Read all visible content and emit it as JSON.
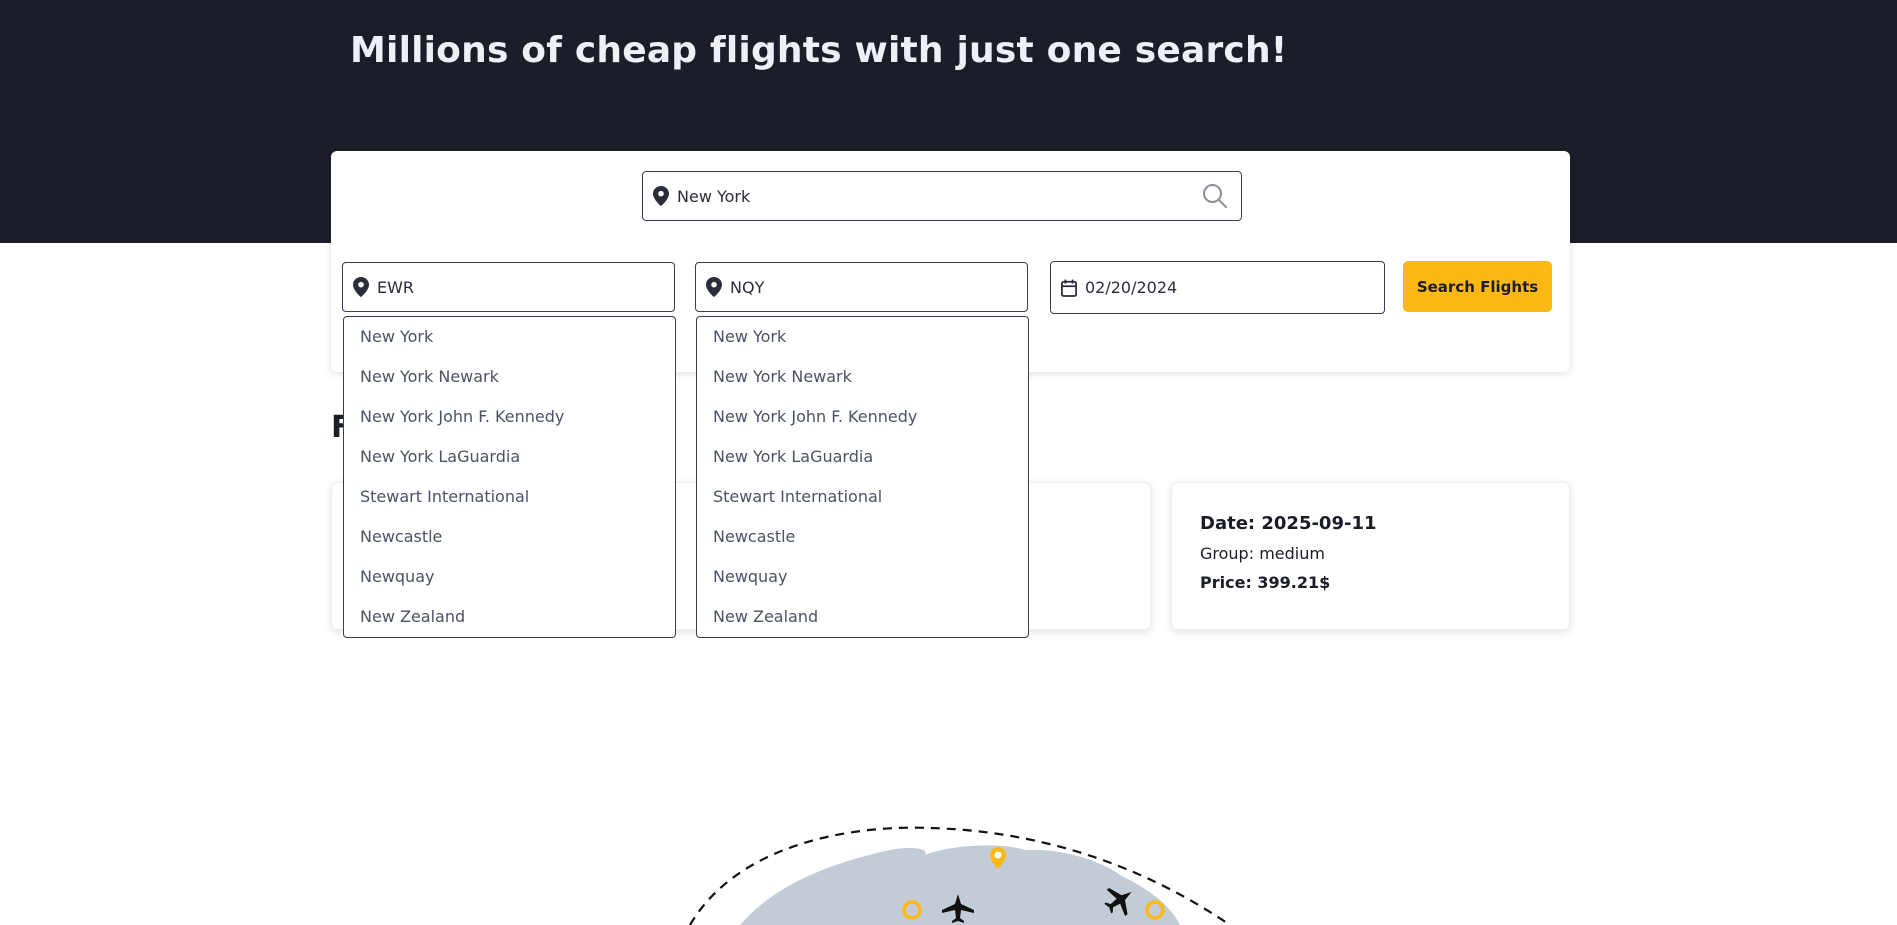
{
  "hero": {
    "title": "Millions of cheap flights with just one search!"
  },
  "search": {
    "city_value": "New York",
    "from_value": "EWR",
    "to_value": "NQY",
    "date_value": "02/20/2024",
    "button_label": "Search Flights"
  },
  "dropdowns": {
    "from_options": [
      "New York",
      "New York Newark",
      "New York John F. Kennedy",
      "New York LaGuardia",
      "Stewart International",
      "Newcastle",
      "Newquay",
      "New Zealand"
    ],
    "to_options": [
      "New York",
      "New York Newark",
      "New York John F. Kennedy",
      "New York LaGuardia",
      "Stewart International",
      "Newcastle",
      "Newquay",
      "New Zealand"
    ]
  },
  "results": {
    "section_title_visible": "F",
    "cards": [
      {
        "date": "Date: 2025-09-11",
        "group": "Group: medium",
        "price": "Price: 399.21$"
      }
    ]
  },
  "colors": {
    "hero_bg": "#1b1d29",
    "accent": "#fdb813",
    "globe": "#c3ccd6"
  },
  "icons": [
    "map-pin-icon",
    "search-icon",
    "calendar-icon",
    "airplane-icon"
  ]
}
